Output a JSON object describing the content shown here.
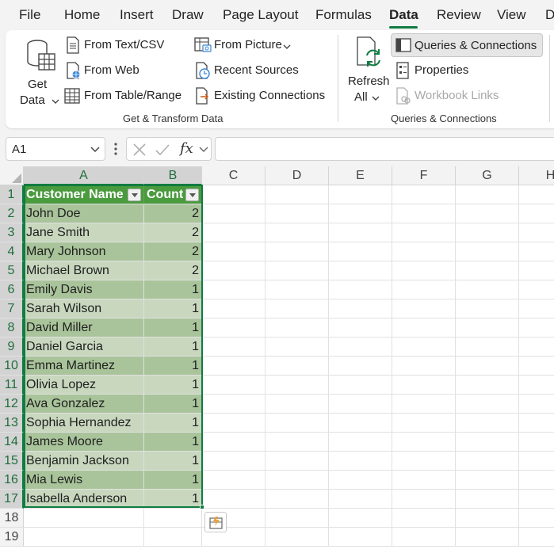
{
  "menu": {
    "tabs": [
      "File",
      "Home",
      "Insert",
      "Draw",
      "Page Layout",
      "Formulas",
      "Data",
      "Review",
      "View",
      "D"
    ],
    "active": "Data"
  },
  "ribbon": {
    "get_data_line1": "Get",
    "get_data_line2": "Data",
    "from_text_csv": "From Text/CSV",
    "from_web": "From Web",
    "from_table_range": "From Table/Range",
    "from_picture": "From Picture",
    "recent_sources": "Recent Sources",
    "existing_connections": "Existing Connections",
    "group_get_transform": "Get & Transform Data",
    "refresh_line1": "Refresh",
    "refresh_line2": "All",
    "queries_connections": "Queries & Connections",
    "properties": "Properties",
    "workbook_links": "Workbook Links",
    "group_queries": "Queries & Connections"
  },
  "formula_bar": {
    "name_box": "A1",
    "fx": "fx",
    "formula": ""
  },
  "sheet": {
    "columns": [
      "A",
      "B",
      "C",
      "D",
      "E",
      "F",
      "G",
      "H"
    ],
    "rows": [
      "1",
      "2",
      "3",
      "4",
      "5",
      "6",
      "7",
      "8",
      "9",
      "10",
      "11",
      "12",
      "13",
      "14",
      "15",
      "16",
      "17",
      "18",
      "19"
    ],
    "table_headers": [
      "Customer Name",
      "Count"
    ],
    "table_rows": [
      [
        "John Doe",
        "2"
      ],
      [
        "Jane Smith",
        "2"
      ],
      [
        "Mary Johnson",
        "2"
      ],
      [
        "Michael Brown",
        "2"
      ],
      [
        "Emily Davis",
        "1"
      ],
      [
        "Sarah Wilson",
        "1"
      ],
      [
        "David Miller",
        "1"
      ],
      [
        "Daniel Garcia",
        "1"
      ],
      [
        "Emma Martinez",
        "1"
      ],
      [
        "Olivia Lopez",
        "1"
      ],
      [
        "Ava Gonzalez",
        "1"
      ],
      [
        "Sophia Hernandez",
        "1"
      ],
      [
        "James Moore",
        "1"
      ],
      [
        "Benjamin Jackson",
        "1"
      ],
      [
        "Mia Lewis",
        "1"
      ],
      [
        "Isabella Anderson",
        "1"
      ]
    ]
  },
  "colors": {
    "accent": "#107c41",
    "table_header": "#4a9a3e",
    "band_dark": "#a9c49a",
    "band_light": "#c8d7be"
  }
}
